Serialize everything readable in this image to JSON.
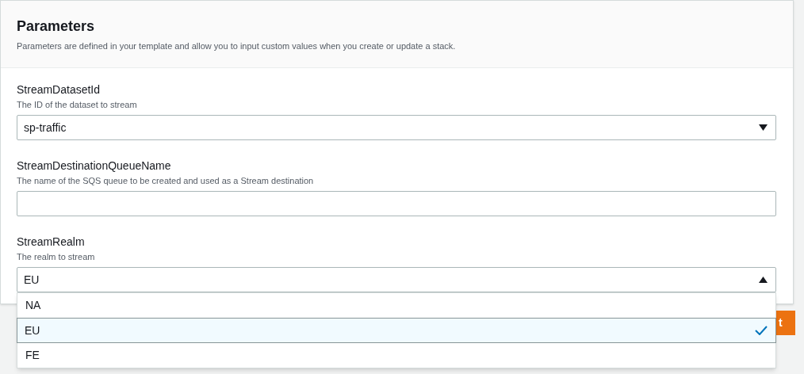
{
  "panel": {
    "title": "Parameters",
    "description": "Parameters are defined in your template and allow you to input custom values when you create or update a stack."
  },
  "fields": [
    {
      "label": "StreamDatasetId",
      "hint": "The ID of the dataset to stream",
      "kind": "select",
      "value": "sp-traffic",
      "expanded": false
    },
    {
      "label": "StreamDestinationQueueName",
      "hint": "The name of the SQS queue to be created and used as a Stream destination",
      "kind": "text"
    },
    {
      "label": "StreamRealm",
      "hint": "The realm to stream",
      "kind": "select",
      "value": "EU",
      "expanded": true,
      "options": [
        {
          "label": "NA",
          "selected": false
        },
        {
          "label": "EU",
          "selected": true
        },
        {
          "label": "FE",
          "selected": false
        }
      ]
    }
  ],
  "partial_button": {
    "label": "t"
  }
}
